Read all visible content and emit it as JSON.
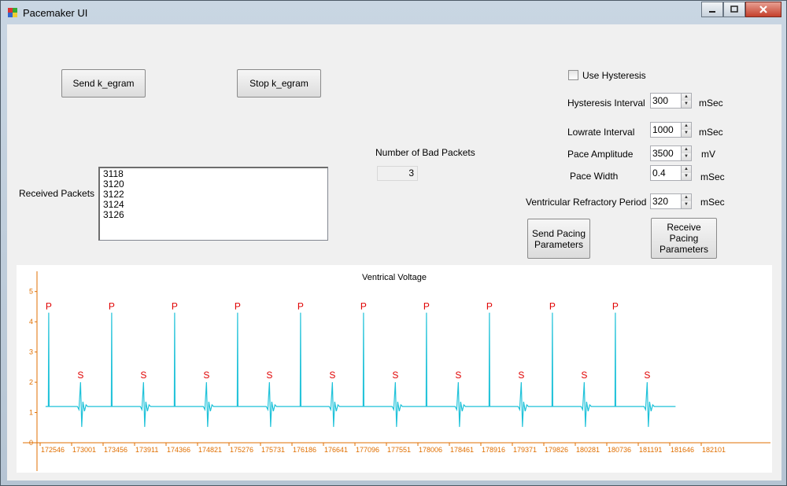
{
  "window": {
    "title": "Pacemaker UI"
  },
  "buttons": {
    "send_egram": "Send k_egram",
    "stop_egram": "Stop k_egram",
    "send_pacing": "Send Pacing Parameters",
    "receive_pacing": "Receive Pacing Parameters"
  },
  "received": {
    "label": "Received Packets",
    "items": [
      "3118",
      "3120",
      "3122",
      "3124",
      "3126"
    ]
  },
  "bad_packets": {
    "label": "Number of Bad Packets",
    "value": "3"
  },
  "hysteresis": {
    "label": "Use Hysteresis",
    "checked": false
  },
  "params": {
    "hysteresis_interval": {
      "label": "Hysteresis Interval",
      "value": "300",
      "unit": "mSec"
    },
    "lowrate_interval": {
      "label": "Lowrate Interval",
      "value": "1000",
      "unit": "mSec"
    },
    "pace_amplitude": {
      "label": "Pace Amplitude",
      "value": "3500",
      "unit": "mV"
    },
    "pace_width": {
      "label": "Pace Width",
      "value": "0.4",
      "unit": "mSec"
    },
    "vrp": {
      "label": "Ventricular Refractory Period",
      "value": "320",
      "unit": "mSec"
    }
  },
  "chart_data": {
    "type": "line",
    "title": "Ventrical Voltage",
    "xlabel": "",
    "ylabel": "",
    "y_ticks": [
      "0",
      "1",
      "2",
      "3",
      "4",
      "5"
    ],
    "ylim": [
      0,
      5.2
    ],
    "x_tick_labels": [
      "172546",
      "173001",
      "173456",
      "173911",
      "174366",
      "174821",
      "175276",
      "175731",
      "176186",
      "176641",
      "177096",
      "177551",
      "178006",
      "178461",
      "178916",
      "179371",
      "179826",
      "180281",
      "180736",
      "181191",
      "181646",
      "182101"
    ],
    "xlim": [
      172546,
      182101
    ],
    "baseline": 1.2,
    "series_color": "#1fc2d9",
    "axis_color": "#e06f00",
    "marker_color": "#e00000",
    "p_peaks": [
      {
        "x": 172670,
        "y": 4.3,
        "label": "P"
      },
      {
        "x": 173580,
        "y": 4.3,
        "label": "P"
      },
      {
        "x": 174490,
        "y": 4.3,
        "label": "P"
      },
      {
        "x": 175400,
        "y": 4.3,
        "label": "P"
      },
      {
        "x": 176310,
        "y": 4.3,
        "label": "P"
      },
      {
        "x": 177220,
        "y": 4.3,
        "label": "P"
      },
      {
        "x": 178130,
        "y": 4.3,
        "label": "P"
      },
      {
        "x": 179040,
        "y": 4.3,
        "label": "P"
      },
      {
        "x": 179950,
        "y": 4.3,
        "label": "P"
      },
      {
        "x": 180860,
        "y": 4.3,
        "label": "P"
      }
    ],
    "s_peaks": [
      {
        "x": 173130,
        "y": 2.0,
        "label": "S"
      },
      {
        "x": 174040,
        "y": 2.0,
        "label": "S"
      },
      {
        "x": 174950,
        "y": 2.0,
        "label": "S"
      },
      {
        "x": 175860,
        "y": 2.0,
        "label": "S"
      },
      {
        "x": 176770,
        "y": 2.0,
        "label": "S"
      },
      {
        "x": 177680,
        "y": 2.0,
        "label": "S"
      },
      {
        "x": 178590,
        "y": 2.0,
        "label": "S"
      },
      {
        "x": 179500,
        "y": 2.0,
        "label": "S"
      },
      {
        "x": 180410,
        "y": 2.0,
        "label": "S"
      },
      {
        "x": 181320,
        "y": 2.0,
        "label": "S"
      }
    ],
    "trace_end_x": 181730
  }
}
